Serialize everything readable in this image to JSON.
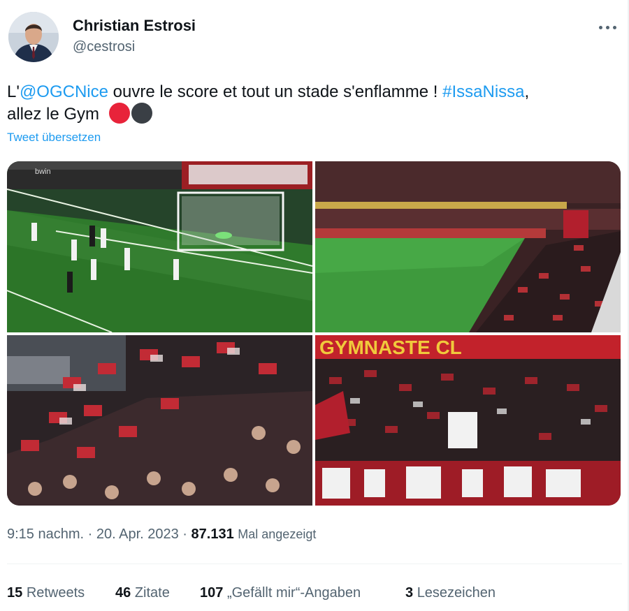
{
  "author": {
    "name": "Christian Estrosi",
    "handle": "@cestrosi"
  },
  "tweet": {
    "line1_prefix": "L'",
    "mention": "@OGCNice",
    "line1_middle": " ouvre le score et tout un stade s'enflamme ! ",
    "hashtag": "#IssaNissa",
    "line1_suffix": ",",
    "line2": "allez le Gym",
    "emoji_colors": [
      "#e8233a",
      "#3a3f45"
    ],
    "translate_label": "Tweet übersetzen"
  },
  "media": {
    "images": [
      "match-goal-photo",
      "stadium-crowd-photo",
      "fans-waving-flags-photo",
      "fan-stand-banner-photo"
    ],
    "banner_text": "GYMNASTE CL",
    "ad_board_text": "bwin"
  },
  "meta": {
    "time": "9:15 nachm.",
    "separator": " · ",
    "date": "20. Apr. 2023",
    "views_count": "87.131",
    "views_label": "Mal angezeigt"
  },
  "stats": {
    "retweets_count": "15",
    "retweets_label": "Retweets",
    "quotes_count": "46",
    "quotes_label": "Zitate",
    "likes_count": "107",
    "likes_label": "„Gefällt mir“-Angaben",
    "bookmarks_count": "3",
    "bookmarks_label": "Lesezeichen"
  }
}
